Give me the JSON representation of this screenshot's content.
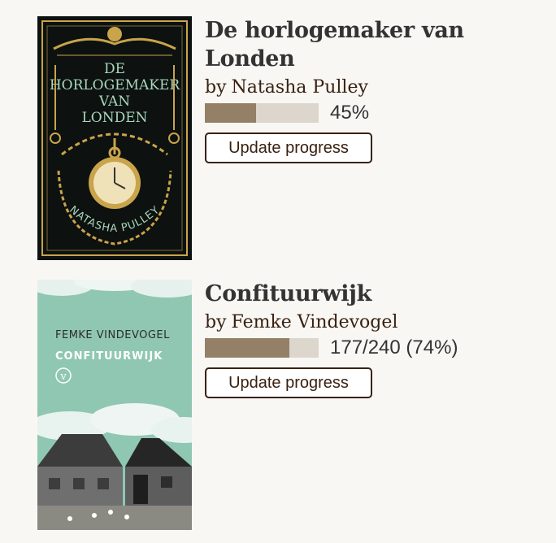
{
  "books": [
    {
      "title": "De horlogemaker van Londen",
      "by_label": "by",
      "author": "Natasha Pulley",
      "progress_text": "45%",
      "progress_fraction": 0.45,
      "button_label": "Update progress",
      "cover": {
        "title_lines": [
          "DE",
          "HORLOGEMAKER",
          "VAN",
          "LONDEN"
        ],
        "author_text": "NATASHA PULLEY",
        "background": "#0d1110",
        "accent": "#c9a44a",
        "text_color": "#a8d8bd"
      }
    },
    {
      "title": "Confituurwijk",
      "by_label": "by",
      "author": "Femke Vindevogel",
      "progress_text": "177/240 (74%)",
      "progress_fraction": 0.74,
      "button_label": "Update progress",
      "cover": {
        "author_text": "FEMKE VINDEVOGEL",
        "title_text": "CONFITUURWIJK",
        "logo_glyph": "v",
        "background": "#8fc7b3"
      }
    }
  ],
  "colors": {
    "page_background": "#f9f7f4",
    "bar_fill": "#948067",
    "bar_track": "#dcd6cc",
    "button_border": "#382110"
  }
}
